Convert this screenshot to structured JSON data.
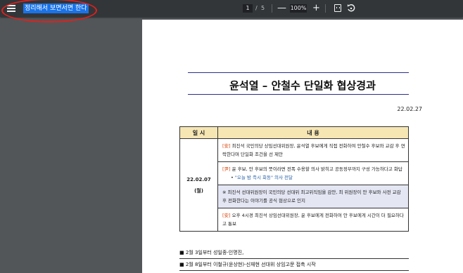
{
  "toolbar": {
    "title": "정리해서 보면서면 한다",
    "current_page": "1",
    "page_sep": "/",
    "total_pages": "5",
    "zoom_out": "—",
    "zoom_level": "100%",
    "zoom_in": "+",
    "icons": [
      "menu-icon",
      "fit-page-icon",
      "rotate-icon"
    ]
  },
  "annotation": {
    "color": "#e0201c"
  },
  "document": {
    "heading": "윤석열 – 안철수 단일화 협상경과",
    "date": "22.02.27",
    "table": {
      "col_date": "일 시",
      "col_content": "내 용",
      "date_value": "22.02.07",
      "date_day": "(월)",
      "entries": [
        {
          "tag": "[安]",
          "text": "최진석 국민의당 상임선대위원장, 윤석열 후보에게 직접 전화하여 안철수 후보와 교감 후 연락한다며 단일화 조건을 선 제안"
        },
        {
          "tag": "[尹]",
          "text": "윤 후보, 안 후보의 뜻이라면 전폭 수용할 의사 밝히고 공동정부까지 구성 가능하다고 화답",
          "bullet": "• ",
          "bullet_text": "\"오늘 밤 즉시 회동\" 의사 전달"
        },
        {
          "tag": "※",
          "text": " 최진석 선대위원장이 국민의당 선대위 최고위직임을 감안, 최 위원장이 안 후보와 사전 교감 후 전화한다는 이야기를 공식 협상으로 인지"
        },
        {
          "tag": "[安]",
          "text": " 오후 4시경 최진석 상임선대위원장, 윤 후보에게 전화하여 안 후보에게 시간이 더 필요하다고 통보"
        }
      ]
    },
    "after_table": [
      "■ 2월 3일부터 성일종-인명진,",
      "■ 2월 8일부터 이철규(윤상현)-신재현 선대위 상임고문 접촉 시작"
    ]
  }
}
